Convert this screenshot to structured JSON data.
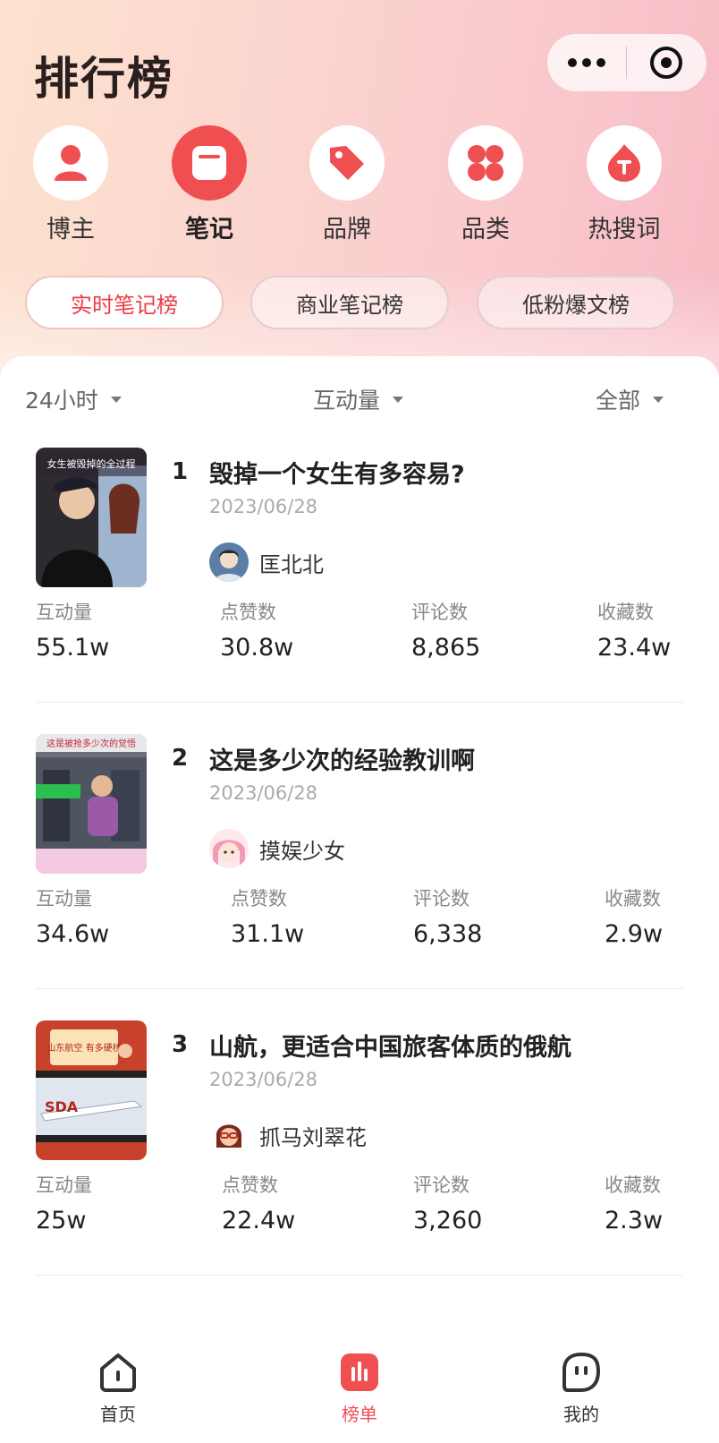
{
  "header": {
    "title": "排行榜"
  },
  "categories": [
    {
      "label": "博主",
      "icon": "person-icon"
    },
    {
      "label": "笔记",
      "icon": "note-icon"
    },
    {
      "label": "品牌",
      "icon": "tag-icon"
    },
    {
      "label": "品类",
      "icon": "grid-icon"
    },
    {
      "label": "热搜词",
      "icon": "fire-icon"
    }
  ],
  "active_category": "笔记",
  "subtabs": [
    "实时笔记榜",
    "商业笔记榜",
    "低粉爆文榜"
  ],
  "active_subtab": "实时笔记榜",
  "filters": {
    "time": "24小时",
    "metric": "互动量",
    "scope": "全部"
  },
  "stat_labels": [
    "互动量",
    "点赞数",
    "评论数",
    "收藏数"
  ],
  "items": [
    {
      "rank": "1",
      "title": "毁掉一个女生有多容易?",
      "date": "2023/06/28",
      "author": "匡北北",
      "thumb_text": "女生被毁掉的全过程",
      "stats": [
        "55.1w",
        "30.8w",
        "8,865",
        "23.4w"
      ]
    },
    {
      "rank": "2",
      "title": "这是多少次的经验教训啊",
      "date": "2023/06/28",
      "author": "摸娱少女",
      "thumb_text": "这是被抢多少次的觉悟",
      "stats": [
        "34.6w",
        "31.1w",
        "6,338",
        "2.9w"
      ]
    },
    {
      "rank": "3",
      "title": "山航，更适合中国旅客体质的俄航",
      "date": "2023/06/28",
      "author": "抓马刘翠花",
      "thumb_text": "山东航空 有多硬核",
      "stats": [
        "25w",
        "22.4w",
        "3,260",
        "2.3w"
      ]
    }
  ],
  "tabbar": [
    {
      "label": "首页",
      "icon": "home-icon"
    },
    {
      "label": "榜单",
      "icon": "chart-icon"
    },
    {
      "label": "我的",
      "icon": "profile-face-icon"
    }
  ],
  "active_tab": "榜单",
  "colors": {
    "accent": "#f04f52",
    "active_text": "#ee3c44"
  }
}
